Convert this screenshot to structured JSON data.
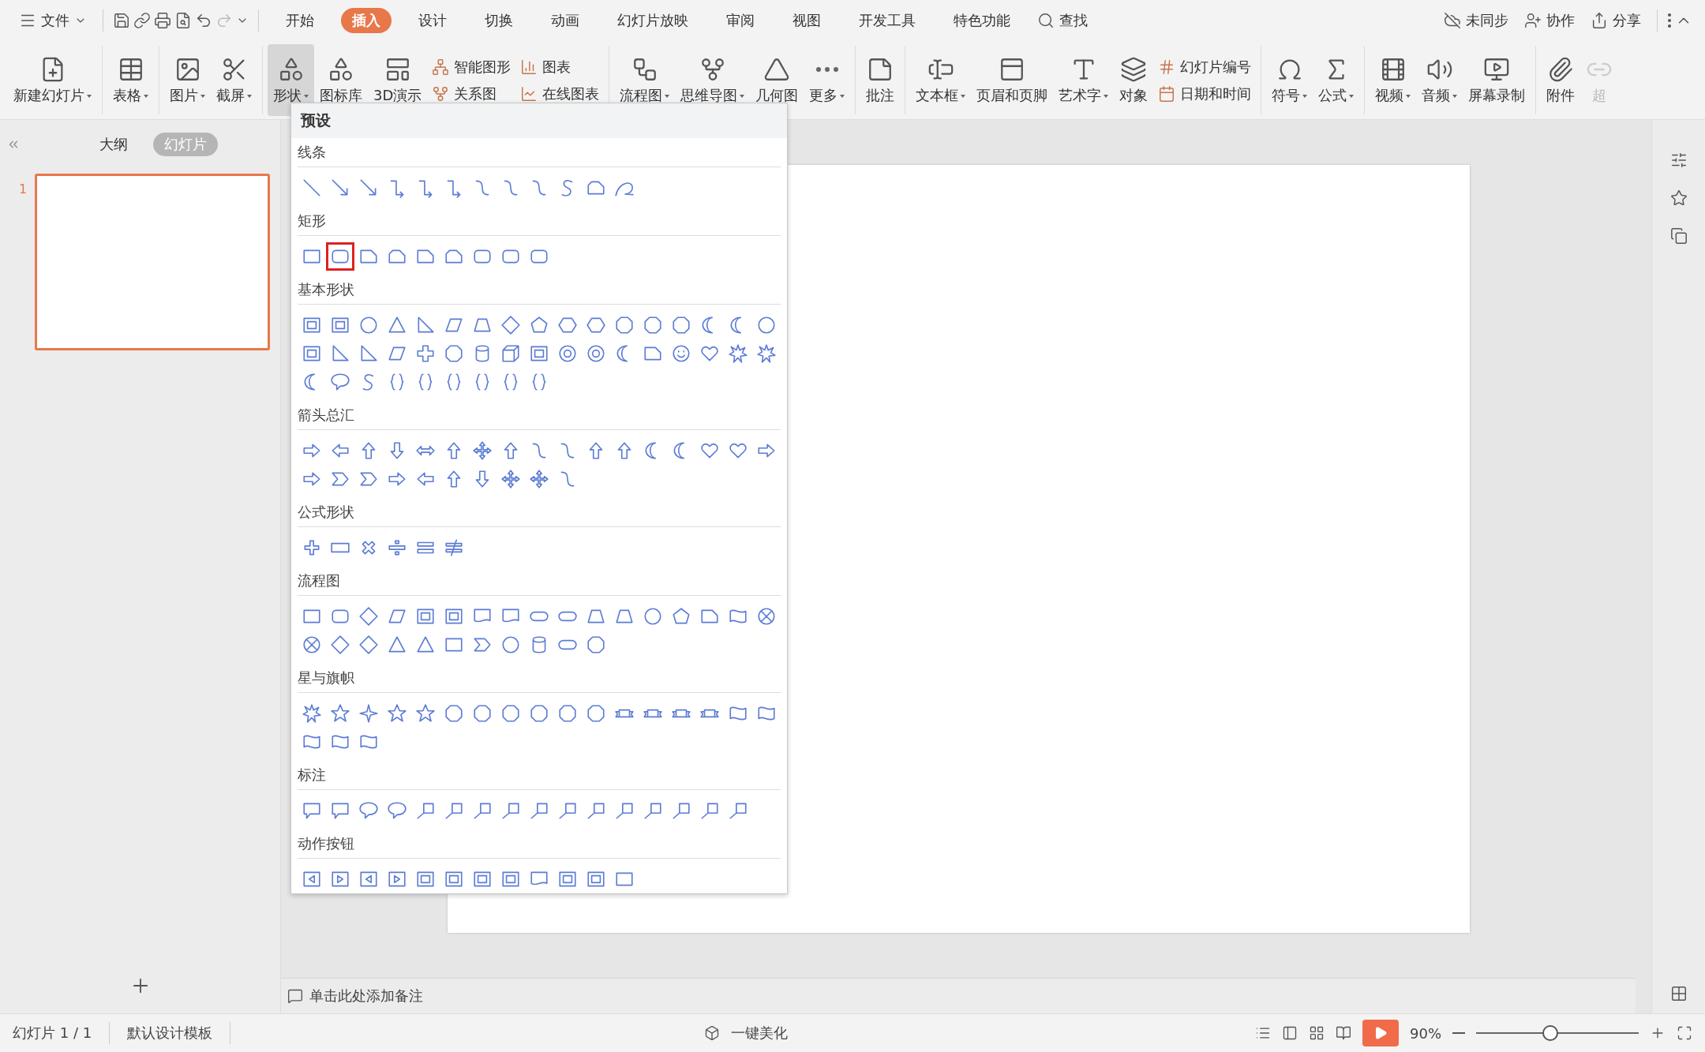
{
  "menu_bar": {
    "file": "文件",
    "tabs": [
      {
        "label": "开始",
        "selected": false
      },
      {
        "label": "插入",
        "selected": true
      },
      {
        "label": "设计",
        "selected": false
      },
      {
        "label": "切换",
        "selected": false
      },
      {
        "label": "动画",
        "selected": false
      },
      {
        "label": "幻灯片放映",
        "selected": false
      },
      {
        "label": "审阅",
        "selected": false
      },
      {
        "label": "视图",
        "selected": false
      },
      {
        "label": "开发工具",
        "selected": false
      },
      {
        "label": "特色功能",
        "selected": false
      }
    ],
    "search": "查找",
    "right": [
      "未同步",
      "协作",
      "分享"
    ]
  },
  "ribbon": [
    {
      "kind": "large",
      "label": "新建幻灯片",
      "caret": true,
      "selected": false
    },
    {
      "kind": "divider"
    },
    {
      "kind": "large",
      "label": "表格",
      "caret": true,
      "selected": false
    },
    {
      "kind": "divider"
    },
    {
      "kind": "large",
      "label": "图片",
      "caret": true,
      "selected": false
    },
    {
      "kind": "large",
      "label": "截屏",
      "caret": true,
      "selected": false
    },
    {
      "kind": "divider"
    },
    {
      "kind": "large",
      "label": "形状",
      "caret": true,
      "selected": true
    },
    {
      "kind": "large",
      "label": "图标库",
      "caret": false,
      "selected": false
    },
    {
      "kind": "large",
      "label": "3D演示",
      "caret": false,
      "selected": false
    },
    {
      "kind": "stack",
      "entries": [
        "智能图形",
        "关系图"
      ]
    },
    {
      "kind": "stack",
      "entries": [
        "图表",
        "在线图表"
      ]
    },
    {
      "kind": "divider"
    },
    {
      "kind": "large",
      "label": "流程图",
      "caret": true,
      "selected": false
    },
    {
      "kind": "large",
      "label": "思维导图",
      "caret": true,
      "selected": false
    },
    {
      "kind": "large",
      "label": "几何图",
      "caret": false,
      "selected": false
    },
    {
      "kind": "large",
      "label": "更多",
      "caret": true,
      "selected": false
    },
    {
      "kind": "divider"
    },
    {
      "kind": "large",
      "label": "批注",
      "caret": false,
      "selected": false
    },
    {
      "kind": "divider"
    },
    {
      "kind": "large",
      "label": "文本框",
      "caret": true,
      "selected": false
    },
    {
      "kind": "large",
      "label": "页眉和页脚",
      "caret": false,
      "selected": false
    },
    {
      "kind": "large",
      "label": "艺术字",
      "caret": true,
      "selected": false
    },
    {
      "kind": "large",
      "label": "对象",
      "caret": false,
      "selected": false
    },
    {
      "kind": "stack",
      "entries": [
        "幻灯片编号",
        "日期和时间"
      ]
    },
    {
      "kind": "divider"
    },
    {
      "kind": "large",
      "label": "符号",
      "caret": true,
      "selected": false
    },
    {
      "kind": "large",
      "label": "公式",
      "caret": true,
      "selected": false
    },
    {
      "kind": "divider"
    },
    {
      "kind": "large",
      "label": "视频",
      "caret": true,
      "selected": false
    },
    {
      "kind": "large",
      "label": "音频",
      "caret": true,
      "selected": false
    },
    {
      "kind": "large",
      "label": "屏幕录制",
      "caret": false,
      "selected": false
    },
    {
      "kind": "divider"
    },
    {
      "kind": "large",
      "label": "附件",
      "caret": false,
      "selected": false
    },
    {
      "kind": "large",
      "label": "超",
      "caret": false,
      "selected": false,
      "disabled": true
    }
  ],
  "left_panel": {
    "tabs": [
      {
        "label": "大纲",
        "selected": false
      },
      {
        "label": "幻灯片",
        "selected": true
      }
    ],
    "slides": [
      {
        "number": "1",
        "selected": true
      }
    ]
  },
  "shapes_menu": {
    "title": "预设",
    "sections": [
      {
        "title": "线条",
        "shapes": [
          {
            "selected": false
          },
          {
            "selected": false
          },
          {
            "selected": false
          },
          {
            "selected": false
          },
          {
            "selected": false
          },
          {
            "selected": false
          },
          {
            "selected": false
          },
          {
            "selected": false
          },
          {
            "selected": false
          },
          {
            "selected": false
          },
          {
            "selected": false
          },
          {
            "selected": false
          }
        ]
      },
      {
        "title": "矩形",
        "shapes": [
          {
            "selected": false
          },
          {
            "selected": true
          },
          {
            "selected": false
          },
          {
            "selected": false
          },
          {
            "selected": false
          },
          {
            "selected": false
          },
          {
            "selected": false
          },
          {
            "selected": false
          },
          {
            "selected": false
          }
        ]
      },
      {
        "title": "基本形状",
        "shapes": [
          {
            "selected": false
          },
          {
            "selected": false
          },
          {
            "selected": false
          },
          {
            "selected": false
          },
          {
            "selected": false
          },
          {
            "selected": false
          },
          {
            "selected": false
          },
          {
            "selected": false
          },
          {
            "selected": false
          },
          {
            "selected": false
          },
          {
            "selected": false
          },
          {
            "selected": false
          },
          {
            "selected": false
          },
          {
            "selected": false
          },
          {
            "selected": false
          },
          {
            "selected": false
          },
          {
            "selected": false
          },
          {
            "selected": false
          },
          {
            "selected": false
          },
          {
            "selected": false
          },
          {
            "selected": false
          },
          {
            "selected": false
          },
          {
            "selected": false
          },
          {
            "selected": false
          },
          {
            "selected": false
          },
          {
            "selected": false
          },
          {
            "selected": false
          },
          {
            "selected": false
          },
          {
            "selected": false
          },
          {
            "selected": false
          },
          {
            "selected": false
          },
          {
            "selected": false
          },
          {
            "selected": false
          },
          {
            "selected": false
          },
          {
            "selected": false
          },
          {
            "selected": false
          },
          {
            "selected": false
          },
          {
            "selected": false
          },
          {
            "selected": false
          },
          {
            "selected": false
          },
          {
            "selected": false
          },
          {
            "selected": false
          },
          {
            "selected": false
          }
        ]
      },
      {
        "title": "箭头总汇",
        "shapes": [
          {
            "selected": false
          },
          {
            "selected": false
          },
          {
            "selected": false
          },
          {
            "selected": false
          },
          {
            "selected": false
          },
          {
            "selected": false
          },
          {
            "selected": false
          },
          {
            "selected": false
          },
          {
            "selected": false
          },
          {
            "selected": false
          },
          {
            "selected": false
          },
          {
            "selected": false
          },
          {
            "selected": false
          },
          {
            "selected": false
          },
          {
            "selected": false
          },
          {
            "selected": false
          },
          {
            "selected": false
          },
          {
            "selected": false
          },
          {
            "selected": false
          },
          {
            "selected": false
          },
          {
            "selected": false
          },
          {
            "selected": false
          },
          {
            "selected": false
          },
          {
            "selected": false
          },
          {
            "selected": false
          },
          {
            "selected": false
          },
          {
            "selected": false
          }
        ]
      },
      {
        "title": "公式形状",
        "shapes": [
          {
            "selected": false
          },
          {
            "selected": false
          },
          {
            "selected": false
          },
          {
            "selected": false
          },
          {
            "selected": false
          },
          {
            "selected": false
          }
        ]
      },
      {
        "title": "流程图",
        "shapes": [
          {
            "selected": false
          },
          {
            "selected": false
          },
          {
            "selected": false
          },
          {
            "selected": false
          },
          {
            "selected": false
          },
          {
            "selected": false
          },
          {
            "selected": false
          },
          {
            "selected": false
          },
          {
            "selected": false
          },
          {
            "selected": false
          },
          {
            "selected": false
          },
          {
            "selected": false
          },
          {
            "selected": false
          },
          {
            "selected": false
          },
          {
            "selected": false
          },
          {
            "selected": false
          },
          {
            "selected": false
          },
          {
            "selected": false
          },
          {
            "selected": false
          },
          {
            "selected": false
          },
          {
            "selected": false
          },
          {
            "selected": false
          },
          {
            "selected": false
          },
          {
            "selected": false
          },
          {
            "selected": false
          },
          {
            "selected": false
          },
          {
            "selected": false
          },
          {
            "selected": false
          }
        ]
      },
      {
        "title": "星与旗帜",
        "shapes": [
          {
            "selected": false
          },
          {
            "selected": false
          },
          {
            "selected": false
          },
          {
            "selected": false
          },
          {
            "selected": false
          },
          {
            "selected": false
          },
          {
            "selected": false
          },
          {
            "selected": false
          },
          {
            "selected": false
          },
          {
            "selected": false
          },
          {
            "selected": false
          },
          {
            "selected": false
          },
          {
            "selected": false
          },
          {
            "selected": false
          },
          {
            "selected": false
          },
          {
            "selected": false
          },
          {
            "selected": false
          },
          {
            "selected": false
          },
          {
            "selected": false
          },
          {
            "selected": false
          }
        ]
      },
      {
        "title": "标注",
        "shapes": [
          {
            "selected": false
          },
          {
            "selected": false
          },
          {
            "selected": false
          },
          {
            "selected": false
          },
          {
            "selected": false
          },
          {
            "selected": false
          },
          {
            "selected": false
          },
          {
            "selected": false
          },
          {
            "selected": false
          },
          {
            "selected": false
          },
          {
            "selected": false
          },
          {
            "selected": false
          },
          {
            "selected": false
          },
          {
            "selected": false
          },
          {
            "selected": false
          },
          {
            "selected": false
          }
        ]
      },
      {
        "title": "动作按钮",
        "shapes": [
          {
            "selected": false
          },
          {
            "selected": false
          },
          {
            "selected": false
          },
          {
            "selected": false
          },
          {
            "selected": false
          },
          {
            "selected": false
          },
          {
            "selected": false
          },
          {
            "selected": false
          },
          {
            "selected": false
          },
          {
            "selected": false
          },
          {
            "selected": false
          },
          {
            "selected": false
          }
        ]
      }
    ]
  },
  "notes": {
    "placeholder": "单击此处添加备注"
  },
  "status_bar": {
    "slide_count": "幻灯片 1 / 1",
    "template": "默认设计模板",
    "beautify": "一键美化",
    "zoom": "90%",
    "zoom_level": {
      "level": 0.45
    }
  }
}
